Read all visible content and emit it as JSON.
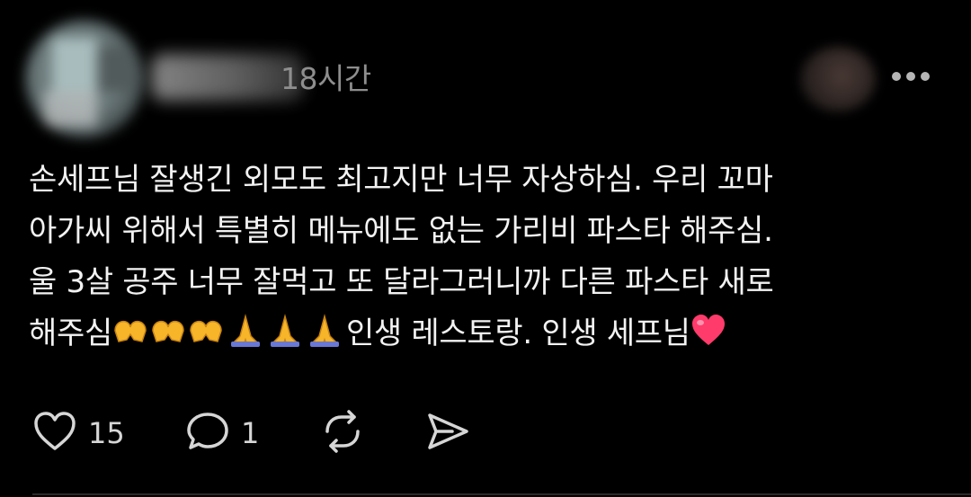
{
  "post": {
    "timestamp": "18시간",
    "text_lines": [
      "손세프님 잘생긴 외모도 최고지만 너무 자상하심. 우리 꼬마",
      "아가씨 위해서 특별히 메뉴에도 없는 가리비 파스타 해주심.",
      "울 3살 공주 너무 잘먹고 또 달라그러니까 다른 파스타 새로",
      "해주심",
      "인생 레스토랑. 인생 세프님"
    ]
  },
  "actions": {
    "like_count": "15",
    "reply_count": "1"
  },
  "icons": {
    "like": "heart-outline-icon",
    "reply": "speech-bubble-icon",
    "repost": "repost-arrows-icon",
    "share": "send-icon",
    "more": "more-horizontal-icon"
  },
  "colors": {
    "background": "#000000",
    "text": "#f2f2f2",
    "muted": "#8e8e8e",
    "heart_emoji": "#ff3b6b"
  }
}
